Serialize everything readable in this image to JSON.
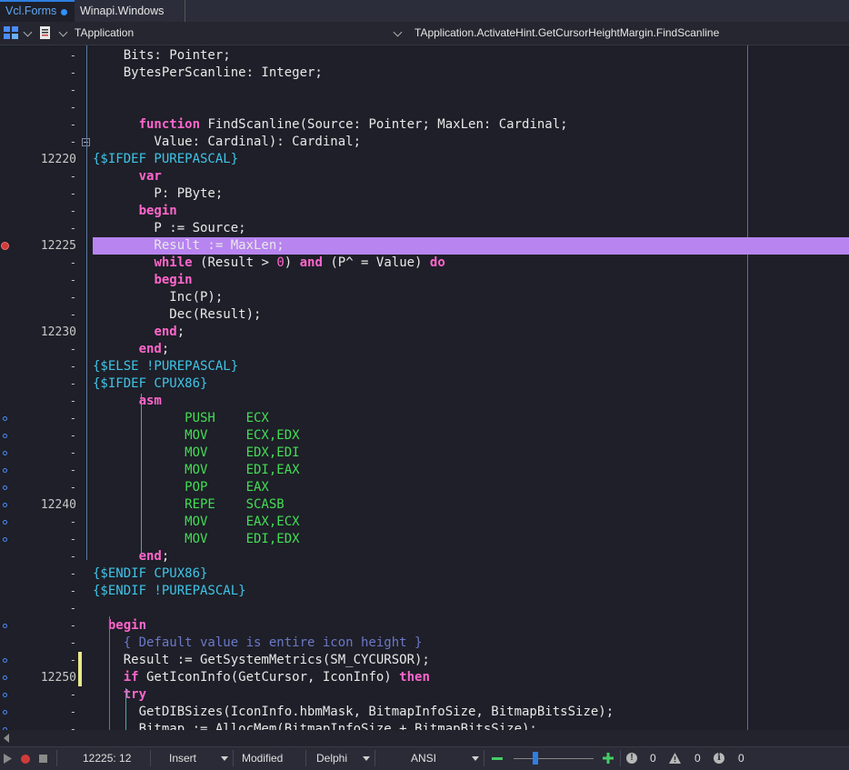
{
  "tabs": [
    {
      "label": "Vcl.Forms",
      "active": true,
      "modified": true
    },
    {
      "label": "Winapi.Windows",
      "active": false
    }
  ],
  "navbar": {
    "class_selector": "TApplication",
    "method_selector": "TApplication.ActivateHint.GetCursorHeightMargin.FindScanline"
  },
  "colors": {
    "keyword": "#ff66cc",
    "directive": "#3fc4e8",
    "asm": "#44dd55",
    "comment": "#6b78c8",
    "highlight": "#b784f0",
    "breakpoint": "#d23a3a"
  },
  "editor": {
    "lines": [
      {
        "num": "-",
        "code": "    Bits: Pointer;"
      },
      {
        "num": "-",
        "code": "    BytesPerScanline: Integer;"
      },
      {
        "num": "-",
        "code": ""
      },
      {
        "num": "-",
        "code": ""
      },
      {
        "num": "-",
        "code": "      function FindScanline(Source: Pointer; MaxLen: Cardinal;"
      },
      {
        "num": "-",
        "code": "        Value: Cardinal): Cardinal;"
      },
      {
        "num": "12220",
        "code": "{$IFDEF PUREPASCAL}"
      },
      {
        "num": "-",
        "code": "      var"
      },
      {
        "num": "-",
        "code": "        P: PByte;"
      },
      {
        "num": "-",
        "code": "      begin"
      },
      {
        "num": "-",
        "code": "        P := Source;"
      },
      {
        "num": "12225",
        "code": "        Result := MaxLen;"
      },
      {
        "num": "-",
        "code": "        while (Result > 0) and (P^ = Value) do"
      },
      {
        "num": "-",
        "code": "        begin"
      },
      {
        "num": "-",
        "code": "          Inc(P);"
      },
      {
        "num": "-",
        "code": "          Dec(Result);"
      },
      {
        "num": "12230",
        "code": "        end;"
      },
      {
        "num": "-",
        "code": "      end;"
      },
      {
        "num": "-",
        "code": "{$ELSE !PUREPASCAL}"
      },
      {
        "num": "-",
        "code": "{$IFDEF CPUX86}"
      },
      {
        "num": "-",
        "code": "      asm"
      },
      {
        "num": "-",
        "code": "            PUSH    ECX"
      },
      {
        "num": "-",
        "code": "            MOV     ECX,EDX"
      },
      {
        "num": "-",
        "code": "            MOV     EDX,EDI"
      },
      {
        "num": "-",
        "code": "            MOV     EDI,EAX"
      },
      {
        "num": "-",
        "code": "            POP     EAX"
      },
      {
        "num": "12240",
        "code": "            REPE    SCASB"
      },
      {
        "num": "-",
        "code": "            MOV     EAX,ECX"
      },
      {
        "num": "-",
        "code": "            MOV     EDI,EDX"
      },
      {
        "num": "-",
        "code": "      end;"
      },
      {
        "num": "-",
        "code": "{$ENDIF CPUX86}"
      },
      {
        "num": "-",
        "code": "{$ENDIF !PUREPASCAL}"
      },
      {
        "num": "-",
        "code": ""
      },
      {
        "num": "-",
        "code": "  begin"
      },
      {
        "num": "-",
        "code": "    { Default value is entire icon height }"
      },
      {
        "num": "-",
        "code": "    Result := GetSystemMetrics(SM_CYCURSOR);"
      },
      {
        "num": "12250",
        "code": "    if GetIconInfo(GetCursor, IconInfo) then"
      },
      {
        "num": "-",
        "code": "    try"
      },
      {
        "num": "-",
        "code": "      GetDIBSizes(IconInfo.hbmMask, BitmapInfoSize, BitmapBitsSize);"
      },
      {
        "num": "-",
        "code": "      Bitmap := AllocMem(BitmapInfoSize + BitmapBitsSize);"
      }
    ]
  },
  "status": {
    "position": "12225:  12",
    "mode": "Insert",
    "state": "Modified",
    "language": "Delphi",
    "encoding": "ANSI",
    "errors": "0",
    "warnings": "0",
    "hints": "0"
  }
}
